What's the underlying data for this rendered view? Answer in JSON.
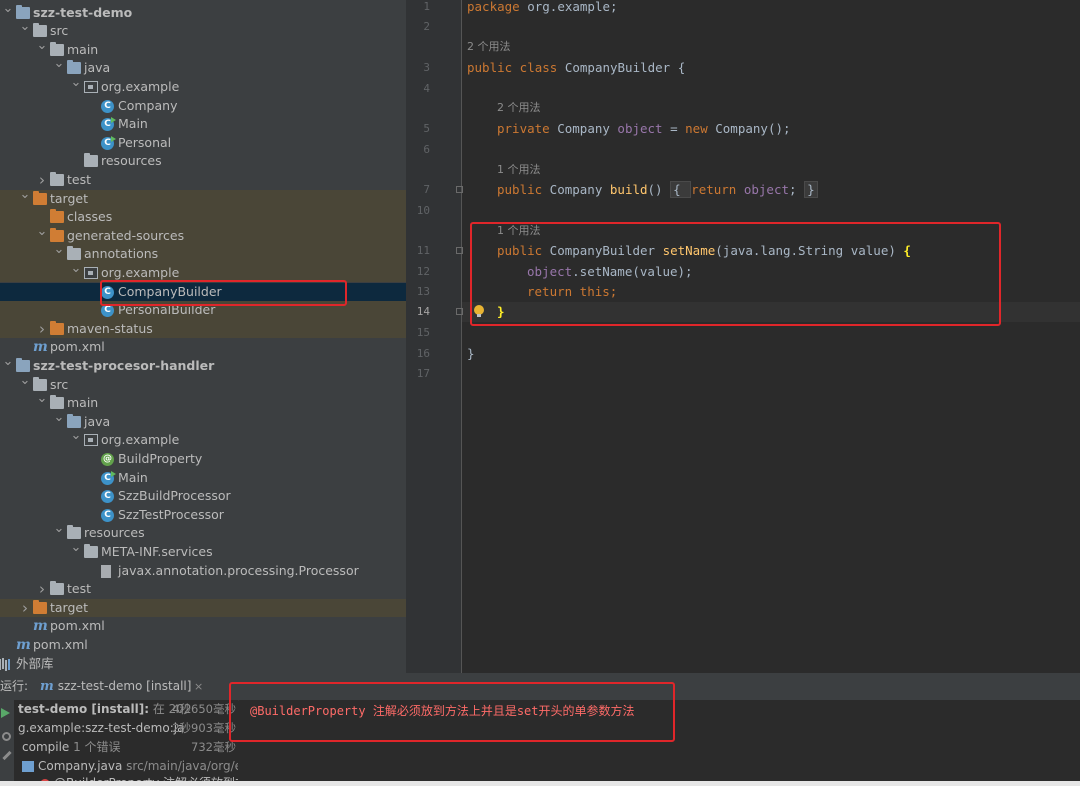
{
  "project_tree": [
    {
      "label": "szz-test-demo",
      "icon": "module-folder-icon",
      "depth": 0,
      "expanded": true,
      "bold": true
    },
    {
      "label": "src",
      "icon": "folder-icon",
      "depth": 1,
      "expanded": true
    },
    {
      "label": "main",
      "icon": "folder-icon",
      "depth": 2,
      "expanded": true
    },
    {
      "label": "java",
      "icon": "source-folder-icon",
      "depth": 3,
      "expanded": true
    },
    {
      "label": "org.example",
      "icon": "package-icon",
      "depth": 4,
      "expanded": true
    },
    {
      "label": "Company",
      "icon": "class-icon",
      "depth": 5
    },
    {
      "label": "Main",
      "icon": "runnable-class-icon",
      "depth": 5
    },
    {
      "label": "Personal",
      "icon": "runnable-class-icon",
      "depth": 5
    },
    {
      "label": "resources",
      "icon": "resources-folder-icon",
      "depth": 4
    },
    {
      "label": "test",
      "icon": "folder-icon",
      "depth": 2,
      "expanded": false
    },
    {
      "label": "target",
      "icon": "excluded-folder-icon",
      "depth": 1,
      "expanded": true,
      "excluded": true
    },
    {
      "label": "classes",
      "icon": "excluded-folder-icon",
      "depth": 2,
      "excluded": true
    },
    {
      "label": "generated-sources",
      "icon": "excluded-folder-icon",
      "depth": 2,
      "expanded": true,
      "excluded": true
    },
    {
      "label": "annotations",
      "icon": "generated-folder-icon",
      "depth": 3,
      "expanded": true,
      "excluded": true
    },
    {
      "label": "org.example",
      "icon": "package-icon",
      "depth": 4,
      "expanded": true,
      "excluded": true
    },
    {
      "label": "CompanyBuilder",
      "icon": "class-icon",
      "depth": 5,
      "selected": true
    },
    {
      "label": "PersonalBuilder",
      "icon": "class-icon",
      "depth": 5,
      "excluded": true
    },
    {
      "label": "maven-status",
      "icon": "excluded-folder-icon",
      "depth": 2,
      "expanded": false,
      "excluded": true
    },
    {
      "label": "pom.xml",
      "icon": "maven-icon",
      "depth": 1
    },
    {
      "label": "szz-test-procesor-handler",
      "icon": "module-folder-icon",
      "depth": 0,
      "expanded": true,
      "bold": true
    },
    {
      "label": "src",
      "icon": "folder-icon",
      "depth": 1,
      "expanded": true
    },
    {
      "label": "main",
      "icon": "folder-icon",
      "depth": 2,
      "expanded": true
    },
    {
      "label": "java",
      "icon": "source-folder-icon",
      "depth": 3,
      "expanded": true
    },
    {
      "label": "org.example",
      "icon": "package-icon",
      "depth": 4,
      "expanded": true
    },
    {
      "label": "BuildProperty",
      "icon": "annotation-icon",
      "depth": 5
    },
    {
      "label": "Main",
      "icon": "runnable-class-icon",
      "depth": 5
    },
    {
      "label": "SzzBuildProcessor",
      "icon": "class-icon",
      "depth": 5
    },
    {
      "label": "SzzTestProcessor",
      "icon": "class-icon",
      "depth": 5
    },
    {
      "label": "resources",
      "icon": "resources-folder-icon",
      "depth": 3,
      "expanded": true
    },
    {
      "label": "META-INF.services",
      "icon": "folder-icon",
      "depth": 4,
      "expanded": true
    },
    {
      "label": "javax.annotation.processing.Processor",
      "icon": "file-icon",
      "depth": 5
    },
    {
      "label": "test",
      "icon": "folder-icon",
      "depth": 2,
      "expanded": false
    },
    {
      "label": "target",
      "icon": "excluded-folder-icon",
      "depth": 1,
      "expanded": false,
      "excluded": true
    },
    {
      "label": "pom.xml",
      "icon": "maven-icon",
      "depth": 1
    },
    {
      "label": "pom.xml",
      "icon": "maven-icon",
      "depth": 0
    },
    {
      "label": "外部库",
      "icon": "library-icon",
      "depth": -1,
      "expanded": false
    }
  ],
  "editor": {
    "line_numbers": [
      "1",
      "2",
      "3",
      "4",
      "5",
      "6",
      "7",
      "10",
      "11",
      "12",
      "13",
      "14",
      "15",
      "16",
      "17"
    ],
    "current_line": "14",
    "usage_hints": [
      "2 个用法",
      "2 个用法",
      "1 个用法",
      "1 个用法"
    ],
    "code": {
      "l1_kw": "package",
      "l1_rest": " org.example;",
      "l3_kw": "public class",
      "l3_rest": " CompanyBuilder {",
      "l5_kw1": "private",
      "l5_type": " Company ",
      "l5_field": "object",
      "l5_eq": " = ",
      "l5_kw2": "new",
      "l5_rest": " Company();",
      "l7_kw": "public",
      "l7_type": " Company ",
      "l7_fn": "build",
      "l7_paren": "() ",
      "l7_fold_open": "{ ",
      "l7_ret": "return",
      "l7_obj": " object",
      "l7_semi": "; ",
      "l7_fold_close": "}",
      "l11_kw": "public",
      "l11_type": " CompanyBuilder ",
      "l11_fn": "setName",
      "l11_params": "(java.lang.String value) ",
      "l11_brace": "{",
      "l12_field": "object",
      "l12_rest": ".setName(value);",
      "l13_kw": "return",
      "l13_kw2": " this",
      "l13_semi": ";",
      "l14_brace": "}",
      "l16_brace": "}"
    }
  },
  "run_panel": {
    "label": "运行:",
    "tab_label": "szz-test-demo [install]",
    "close": "×",
    "rows": [
      {
        "text": "test-demo [install]:",
        "extra": " 在 202",
        "time": "4秒650毫秒"
      },
      {
        "text": "g.example:szz-test-demo:ja",
        "time": "2秒903毫秒"
      },
      {
        "text": "compile",
        "extra": "  1 个错误",
        "time": "732毫秒"
      },
      {
        "text": "Company.java",
        "extra": " src/main/java/org/exa",
        "time": ""
      },
      {
        "text": "@BuilderProperty 注解必须放到方",
        "time": ""
      }
    ],
    "console_error": "@BuilderProperty 注解必须放到方法上并且是set开头的单参数方法"
  },
  "colors": {
    "sidebar_bg": "#3c3f41",
    "editor_bg": "#2b2b2b",
    "selection_bg": "#0d293e",
    "excluded_bg": "#4a4637",
    "keyword": "#cc7832",
    "field": "#9876aa",
    "function": "#ffc66d",
    "error_text": "#ff6b68",
    "annotation_box": "#e0262a"
  }
}
